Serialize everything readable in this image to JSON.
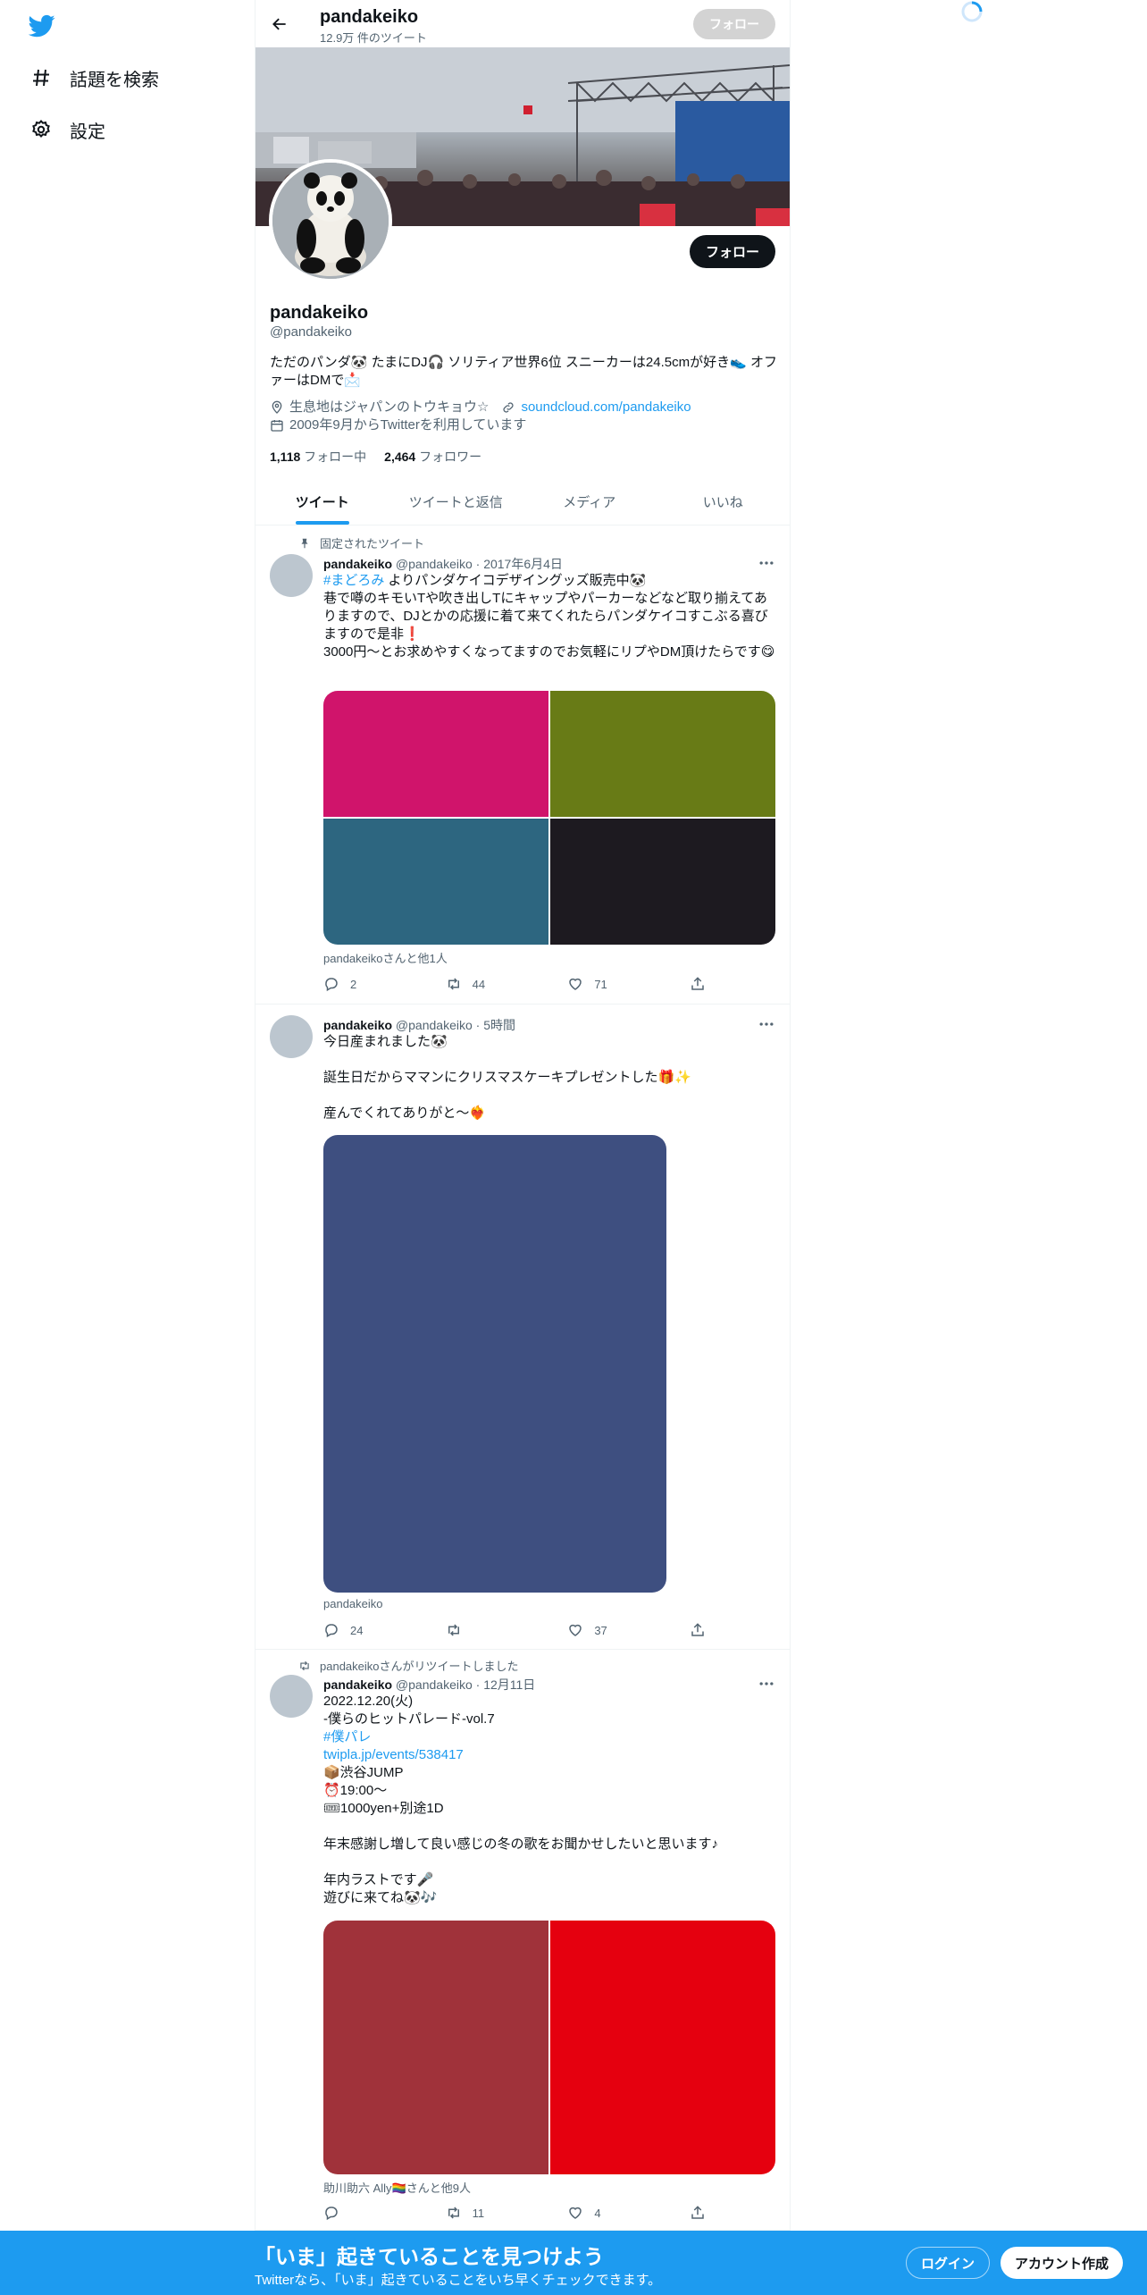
{
  "sidebar": {
    "items": [
      {
        "label": "話題を検索",
        "icon": "hashtag-icon"
      },
      {
        "label": "設定",
        "icon": "gear-icon"
      }
    ]
  },
  "header": {
    "name": "pandakeiko",
    "tweet_count": "12.9万 件のツイート",
    "follow_label": "フォロー"
  },
  "profile": {
    "follow_label": "フォロー",
    "name": "pandakeiko",
    "handle": "@pandakeiko",
    "bio": "ただのパンダ🐼 たまにDJ🎧 ソリティア世界6位 スニーカーは24.5cmが好き👟 オファーはDMで📩",
    "location": "生息地はジャパンのトウキョウ☆",
    "website": "soundcloud.com/pandakeiko",
    "joined": "2009年9月からTwitterを利用しています",
    "following_count": "1,118",
    "following_label": "フォロー中",
    "followers_count": "2,464",
    "followers_label": "フォロワー"
  },
  "tabs": [
    "ツイート",
    "ツイートと返信",
    "メディア",
    "いいね"
  ],
  "tweets": [
    {
      "context": "固定されたツイート",
      "name": "pandakeiko",
      "handle": "@pandakeiko",
      "time": "2017年6月4日",
      "hashtag": "#まどろみ",
      "line1_rest": " よりパンダケイコデザイングッズ販売中🐼",
      "line2": "巷で噂のキモいTや吹き出しTにキャップやパーカーなどなど取り揃えてありますので、DJとかの応援に着て来てくれたらパンダケイコすこぶる喜びますので是非❗️",
      "line3": "3000円〜とお求めやすくなってますのでお気軽にリプやDM頂けたらです😋",
      "media_colors": [
        "#d0146b",
        "#687b16",
        "#2d6680",
        "#1d1a20"
      ],
      "tagged": "pandakeikoさんと他1人",
      "replies": "2",
      "retweets": "44",
      "likes": "71"
    },
    {
      "name": "pandakeiko",
      "handle": "@pandakeiko",
      "time": "5時間",
      "lines": [
        "今日産まれました🐼",
        "",
        "誕生日だからママンにクリスマスケーキプレゼントした🎁✨",
        "",
        "産んでくれてありがと〜❤️‍🔥"
      ],
      "media_colors": [
        "#3e4f80"
      ],
      "tagged": "pandakeiko",
      "replies": "24",
      "retweets": "",
      "likes": "37"
    },
    {
      "context": "pandakeikoさんがリツイートしました",
      "name": "pandakeiko",
      "handle": "@pandakeiko",
      "time": "12月11日",
      "line1": "2022.12.20(火)",
      "line2": "-僕らのヒットパレード-vol.7",
      "hashtag": "#僕パレ",
      "link": "twipla.jp/events/538417",
      "line5": "📦渋谷JUMP",
      "line6": "⏰19:00〜",
      "line7": "🎟1000yen+別途1D",
      "line9": "年末感謝し増して良い感じの冬の歌をお聞かせしたいと思います♪",
      "line11": "年内ラストです🎤",
      "line12": "遊びに来てね🐼🎶",
      "media_colors": [
        "#a0323a",
        "#e5000f"
      ],
      "tagged": "助川助六 Ally🏳️‍🌈さんと他9人",
      "replies": "",
      "retweets": "11",
      "likes": "4"
    }
  ],
  "bottombar": {
    "title": "「いま」起きていることを見つけよう",
    "subtitle": "Twitterなら、「いま」起きていることをいち早くチェックできます。",
    "login": "ログイン",
    "signup": "アカウント作成"
  },
  "colors": {
    "accent": "#1d9bf0",
    "text": "#0f1419",
    "muted": "#536471"
  }
}
